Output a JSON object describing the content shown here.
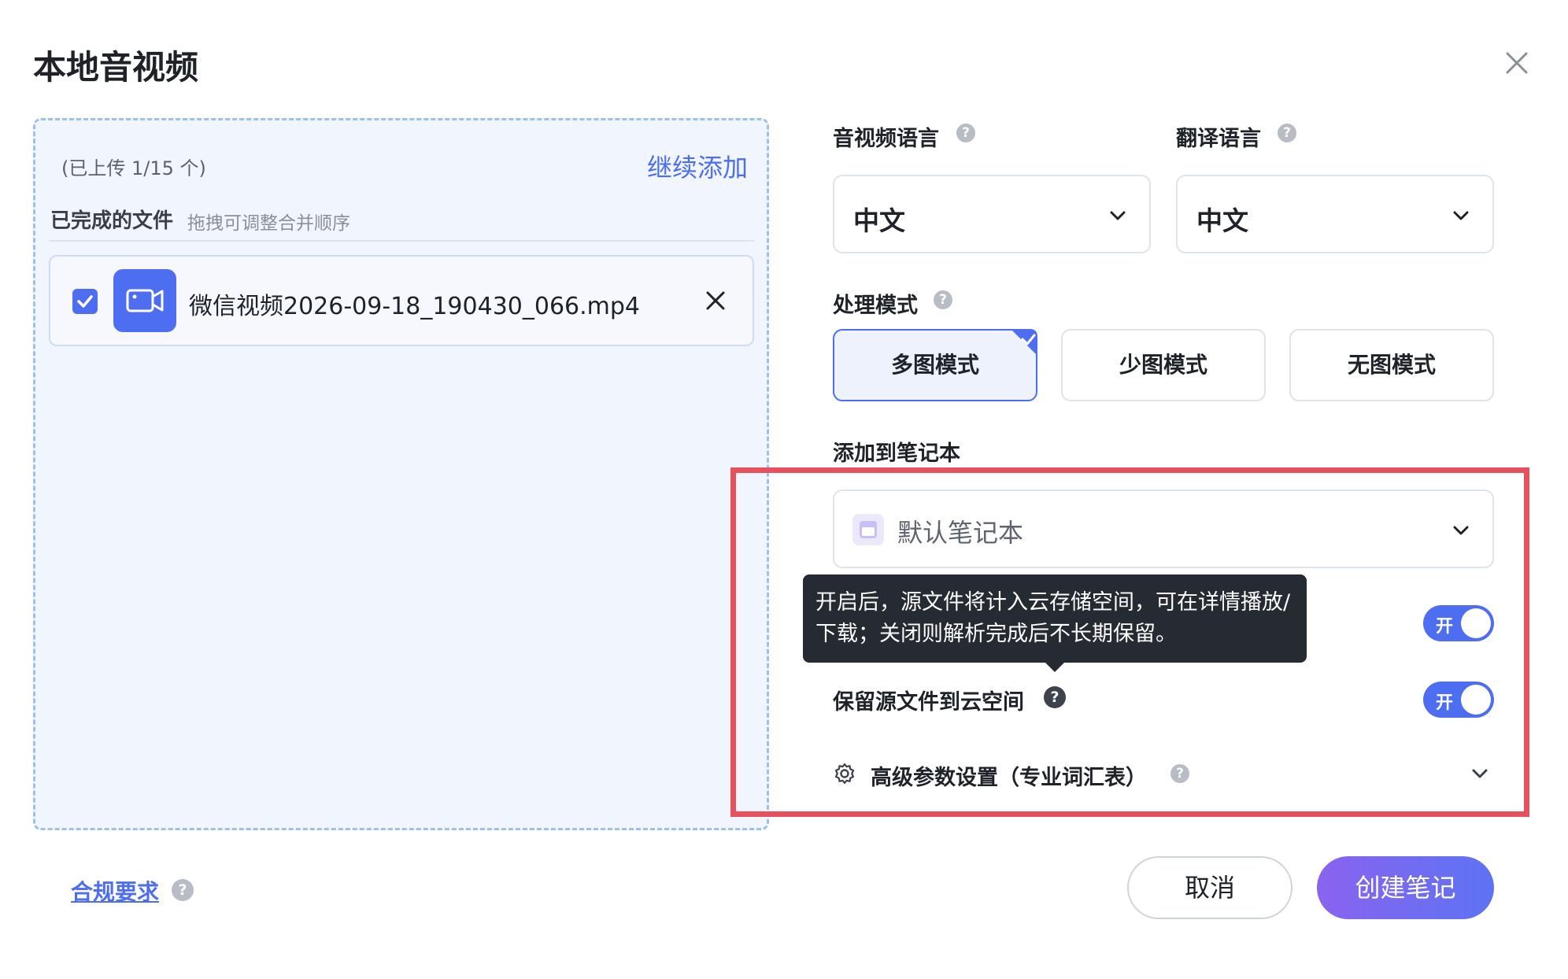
{
  "dialog": {
    "title": "本地音视频"
  },
  "upload": {
    "count_text": "(已上传 1/15 个)",
    "continue_add": "继续添加",
    "done_title": "已完成的文件",
    "done_hint": "拖拽可调整合并顺序",
    "files": [
      {
        "name": "微信视频2026-09-18_190430_066.mp4",
        "checked": true
      }
    ]
  },
  "form": {
    "av_language_label": "音视频语言",
    "av_language_value": "中文",
    "translate_language_label": "翻译语言",
    "translate_language_value": "中文",
    "mode_label": "处理模式",
    "modes": [
      "多图模式",
      "少图模式",
      "无图模式"
    ],
    "selected_mode": "多图模式",
    "notebook_label": "添加到笔记本",
    "notebook_value": "默认笔记本",
    "tooltip": "开启后，源文件将计入云存储空间，可在详情播放/下载；关闭则解析完成后不长期保留。",
    "toggle_on_text": "开",
    "keep_source_label": "保留源文件到云空间",
    "advanced_label": "高级参数设置（专业词汇表）"
  },
  "footer": {
    "compliance": "合规要求",
    "cancel": "取消",
    "create": "创建笔记"
  },
  "icons": {
    "help": "?"
  },
  "colors": {
    "accent": "#4e6ef2",
    "highlight_border": "#e8505b",
    "create_gradient_start": "#8a63ef",
    "create_gradient_end": "#5d73f3"
  }
}
